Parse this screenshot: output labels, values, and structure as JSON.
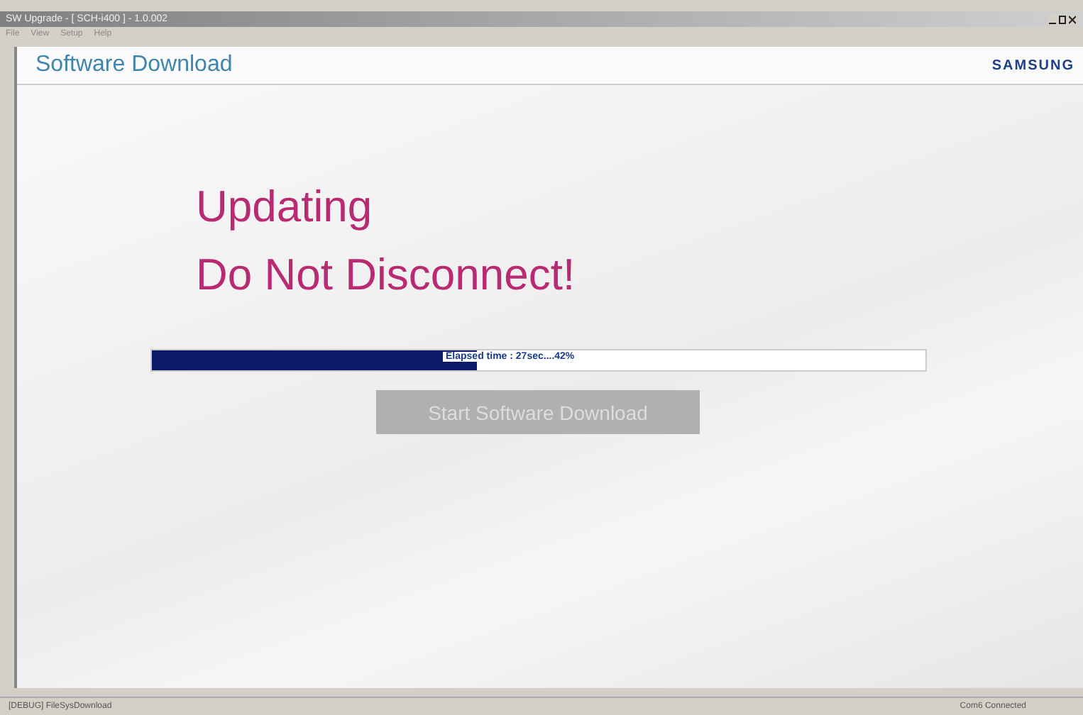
{
  "window": {
    "title": "SW Upgrade - [ SCH-i400 ] - 1.0.002"
  },
  "menu": [
    "File",
    "View",
    "Setup",
    "Help"
  ],
  "header": {
    "title": "Software Download",
    "logo": "SAMSUNG"
  },
  "message": [
    "Updating",
    "Do Not Disconnect!"
  ],
  "progress": {
    "level": 0.42,
    "text": "Elapsed time : 27sec....42%"
  },
  "button": {
    "label": "Start Software Download",
    "disabled": true
  },
  "status_bar": {
    "left": "[DEBUG] FileSysDownload",
    "right": "Com6 Connected"
  }
}
